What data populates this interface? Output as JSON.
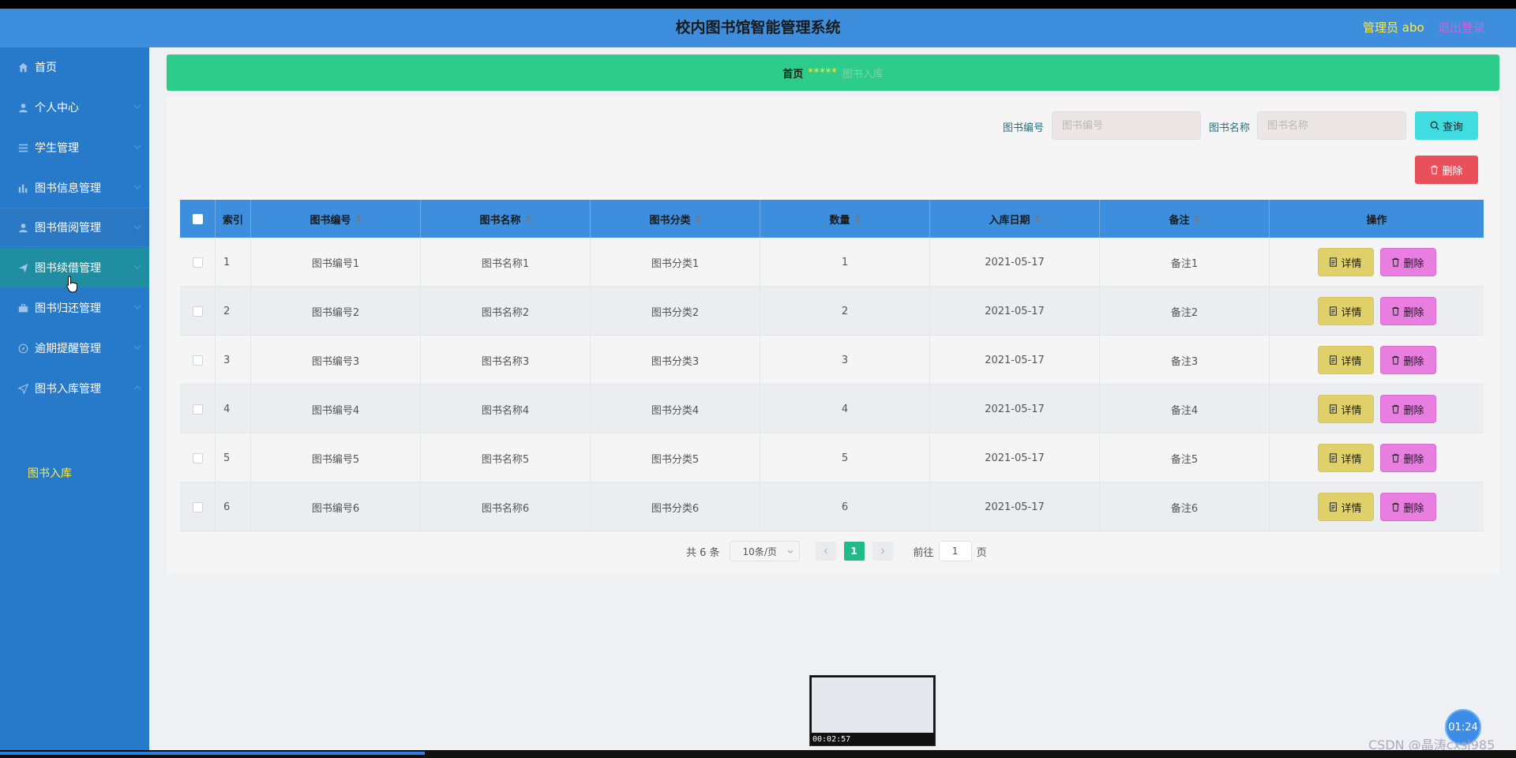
{
  "header": {
    "title": "校内图书馆智能管理系统",
    "user": "管理员 abo",
    "logout": "退出登录"
  },
  "sidebar": {
    "items": [
      {
        "label": "首页",
        "icon": "home-icon"
      },
      {
        "label": "个人中心",
        "icon": "user-icon"
      },
      {
        "label": "学生管理",
        "icon": "list-icon"
      },
      {
        "label": "图书信息管理",
        "icon": "chart-icon"
      },
      {
        "label": "图书借阅管理",
        "icon": "user-icon"
      },
      {
        "label": "图书续借管理",
        "icon": "send-icon"
      },
      {
        "label": "图书归还管理",
        "icon": "briefcase-icon"
      },
      {
        "label": "逾期提醒管理",
        "icon": "compass-icon"
      },
      {
        "label": "图书入库管理",
        "icon": "location-icon"
      }
    ],
    "submenu": {
      "label": "图书入库"
    }
  },
  "breadcrumb": {
    "home": "首页",
    "separator": "*****",
    "current": "图书入库"
  },
  "search": {
    "code_label": "图书编号",
    "code_placeholder": "图书编号",
    "name_label": "图书名称",
    "name_placeholder": "图书名称",
    "query_button": "查询",
    "delete_button": "删除"
  },
  "table": {
    "headers": [
      "索引",
      "图书编号",
      "图书名称",
      "图书分类",
      "数量",
      "入库日期",
      "备注",
      "操作"
    ],
    "rows": [
      {
        "index": "1",
        "code": "图书编号1",
        "name": "图书名称1",
        "category": "图书分类1",
        "qty": "1",
        "date": "2021-05-17",
        "note": "备注1"
      },
      {
        "index": "2",
        "code": "图书编号2",
        "name": "图书名称2",
        "category": "图书分类2",
        "qty": "2",
        "date": "2021-05-17",
        "note": "备注2"
      },
      {
        "index": "3",
        "code": "图书编号3",
        "name": "图书名称3",
        "category": "图书分类3",
        "qty": "3",
        "date": "2021-05-17",
        "note": "备注3"
      },
      {
        "index": "4",
        "code": "图书编号4",
        "name": "图书名称4",
        "category": "图书分类4",
        "qty": "4",
        "date": "2021-05-17",
        "note": "备注4"
      },
      {
        "index": "5",
        "code": "图书编号5",
        "name": "图书名称5",
        "category": "图书分类5",
        "qty": "5",
        "date": "2021-05-17",
        "note": "备注5"
      },
      {
        "index": "6",
        "code": "图书编号6",
        "name": "图书名称6",
        "category": "图书分类6",
        "qty": "6",
        "date": "2021-05-17",
        "note": "备注6"
      }
    ],
    "detail_button": "详情",
    "delete_button": "删除"
  },
  "pager": {
    "total": "共 6 条",
    "page_size": "10条/页",
    "current_page": "1",
    "goto_label": "前往",
    "goto_value": "1",
    "page_suffix": "页"
  },
  "video": {
    "thumb_time": "00:02:57",
    "timer": "01:24",
    "progress": 0.28
  },
  "watermark": "CSDN @晶涛cxsj985",
  "colors": {
    "header": "#3d8fde",
    "sidebar": "#2779c9",
    "breadcrumb": "#2ecc8a",
    "detail_button": "#e0d06a",
    "delete_button": "#e87fe0",
    "query_button": "#40dce0",
    "delete_top_button": "#e8505a"
  }
}
